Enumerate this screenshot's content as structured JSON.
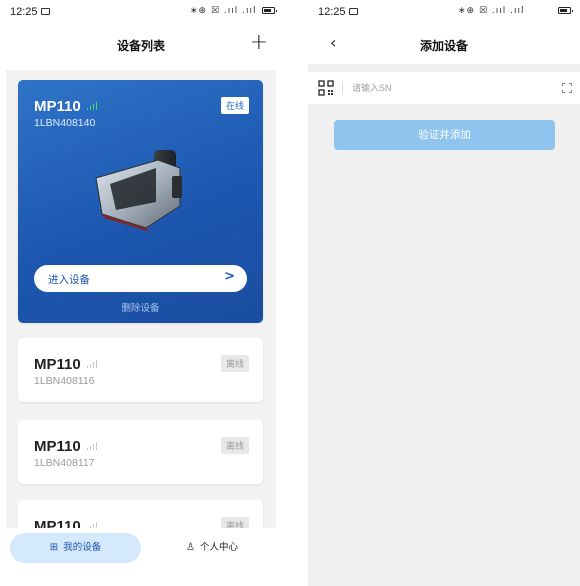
{
  "device_list_screen": {
    "status": {
      "time": "12:25",
      "icons": "∗⊕ ☒ .ııl .ııl"
    },
    "title": "设备列表",
    "add_icon": "+",
    "devices": [
      {
        "model": "MP110",
        "sn": "1LBN408140",
        "status": "在线",
        "online": true,
        "enter_label": "进入设备",
        "delete_label": "删除设备"
      },
      {
        "model": "MP110",
        "sn": "1LBN408116",
        "status": "离线",
        "online": false
      },
      {
        "model": "MP110",
        "sn": "1LBN408117",
        "status": "离线",
        "online": false
      },
      {
        "model": "MP110",
        "sn": "",
        "status": "离线",
        "online": false
      }
    ],
    "tabs": {
      "my_devices": "我的设备",
      "personal": "个人中心"
    }
  },
  "add_device_screen": {
    "status": {
      "time": "12:25",
      "icons": "∗⊕ ☒ .ııl .ııl"
    },
    "title": "添加设备",
    "back_icon": "‹",
    "sn_placeholder": "请输入SN",
    "submit_label": "验证并添加"
  },
  "colors": {
    "primary": "#1d57b0",
    "button_disabled": "#8ec4ed",
    "tab_active_bg": "#d4e9fb",
    "online_signal": "#4cd964",
    "background": "#f2f2f2"
  }
}
